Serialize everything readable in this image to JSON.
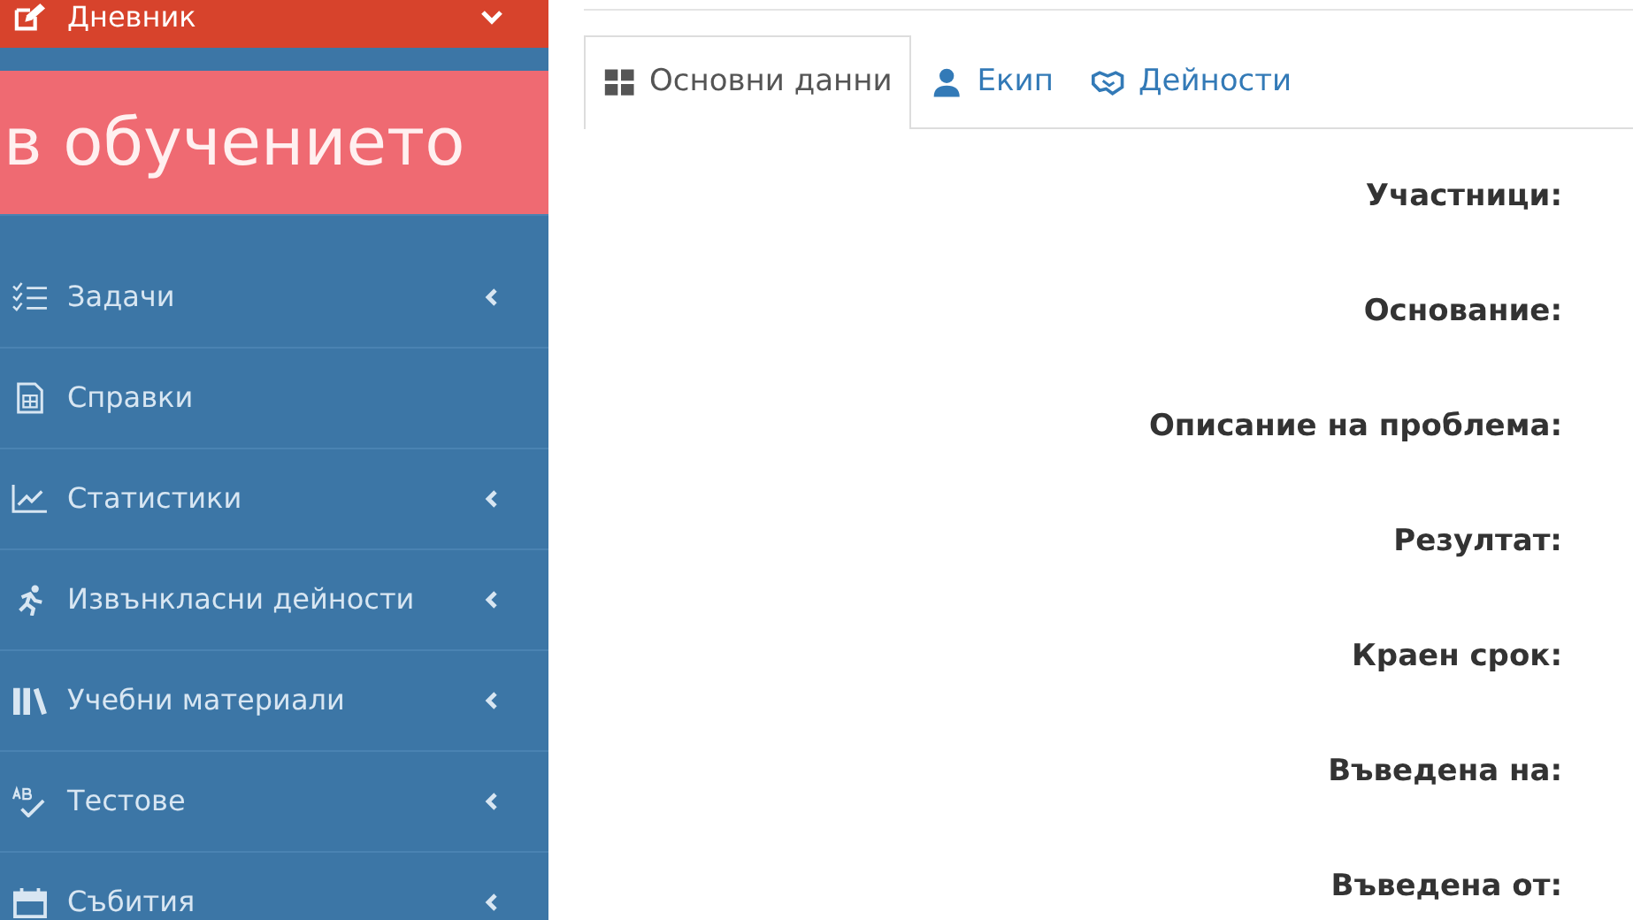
{
  "sidebar": {
    "items": [
      {
        "label": "Дневник",
        "kind": "submenu",
        "expanded": true
      },
      {
        "label": "Задачи",
        "kind": "submenu",
        "expanded": false
      },
      {
        "label": "Справки",
        "kind": "link",
        "expanded": false
      },
      {
        "label": "Статистики",
        "kind": "submenu",
        "expanded": false
      },
      {
        "label": "Извънкласни дейности",
        "kind": "submenu",
        "expanded": false
      },
      {
        "label": "Учебни материали",
        "kind": "submenu",
        "expanded": false
      },
      {
        "label": "Тестове",
        "kind": "submenu",
        "expanded": false
      },
      {
        "label": "Събития",
        "kind": "submenu",
        "expanded": false
      }
    ],
    "banner": "в обучението"
  },
  "tabs": [
    {
      "label": "Основни данни",
      "selected": true
    },
    {
      "label": "Екип",
      "selected": false
    },
    {
      "label": "Дейности",
      "selected": false
    }
  ],
  "fields": [
    {
      "label": "Участници:"
    },
    {
      "label": "Основание:"
    },
    {
      "label": "Описание на проблема:"
    },
    {
      "label": "Резултат:"
    },
    {
      "label": "Краен срок:"
    },
    {
      "label": "Въведена на:"
    },
    {
      "label": "Въведена от:"
    }
  ]
}
